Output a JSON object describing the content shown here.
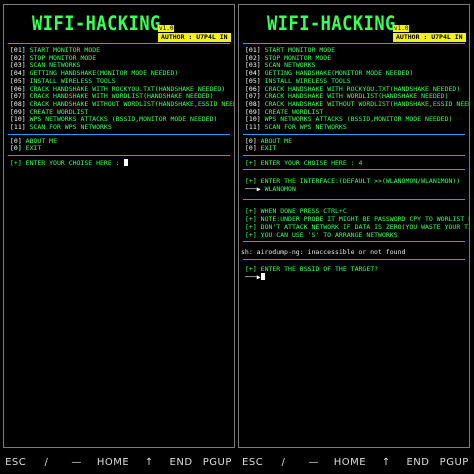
{
  "app": {
    "logo": "WIFI-HACKING",
    "version_badge": "v1.0",
    "author_badge": "AUTHOR : U7P4L IN"
  },
  "menu": [
    {
      "key": "[01]",
      "label": "START MONITOR MODE"
    },
    {
      "key": "[02]",
      "label": "STOP MONITOR MODE"
    },
    {
      "key": "[03]",
      "label": "SCAN NETWORKS"
    },
    {
      "key": "[04]",
      "label": "GETTING HANDSHAKE(MONITOR MODE NEEDED)"
    },
    {
      "key": "[05]",
      "label": "INSTALL WIRELESS TOOLS"
    },
    {
      "key": "[06]",
      "label": "CRACK HANDSHAKE WITH ROCKYOU.TXT(HANDSHAKE NEEDED)"
    },
    {
      "key": "[07]",
      "label": "CRACK HANDSHAKE WITH WORDLIST(HANDSHAKE NEEDED)"
    },
    {
      "key": "[08]",
      "label": "CRACK HANDSHAKE WITHOUT WORDLIST(HANDSHAKE,ESSID NEEDED)"
    },
    {
      "key": "[09]",
      "label": "CREATE WORDLIST"
    },
    {
      "key": "[10]",
      "label": "WPS NETWORKS ATTACKS (BSSID,MONITOR MODE NEEDED)"
    },
    {
      "key": "[11]",
      "label": "SCAN FOR WPS NETWORKS"
    }
  ],
  "menu_extra": [
    {
      "key": "[0]",
      "label": "ABOUT ME"
    },
    {
      "key": "[0]",
      "label": "EXIT"
    }
  ],
  "left": {
    "prompt": "[+] ENTER YOUR CHOISE HERE : "
  },
  "right": {
    "prompt_choice": "[+] ENTER YOUR CHOISE HERE : 4",
    "prompt_interface": "[+] ENTER THE INTERFACE:(DEFAULT >>(WLANOMON/WLAN1MON))",
    "interface_value": "WLANOMON",
    "notes": [
      "[+] WHEN DONE PRESS CTRL+C",
      "[+] NOTE:UNDER PROBE IT MIGHT BE PASSWORD CPY TO WORLIST FILE",
      "[+] DON'T ATTACK NETWORK IF DATA IS ZERO(YOU WASTE YOUR TIME)",
      "[+] YOU CAN USE 'S' TO ARRANGE NETWORKS"
    ],
    "error": "sh: airodump-ng: inaccessible or not found",
    "prompt_bssid": "[+] ENTER THE BSSID OF THE TARGET?"
  },
  "keys": [
    "ESC",
    "/",
    "—",
    "HOME",
    "↑",
    "END",
    "PGUP"
  ],
  "colors": {
    "text_green": "#39ff5a",
    "separator_blue": "#2a9bff",
    "badge_yellow": "#f2f21a"
  }
}
